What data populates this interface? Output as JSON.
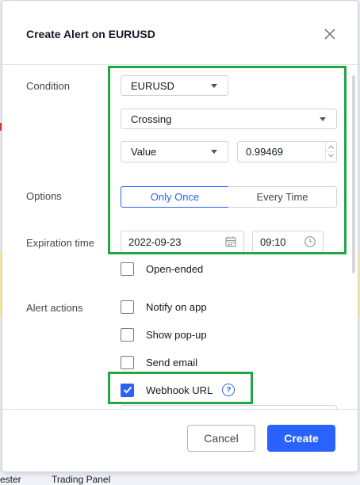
{
  "dialog": {
    "title": "Create Alert on EURUSD"
  },
  "condition": {
    "label": "Condition",
    "symbol": "EURUSD",
    "operator": "Crossing",
    "source": "Value",
    "value": "0.99469"
  },
  "options": {
    "label": "Options",
    "only_once": "Only Once",
    "every_time": "Every Time",
    "selected": "Only Once"
  },
  "expiration": {
    "label": "Expiration time",
    "date": "2022-09-23",
    "time": "09:10",
    "open_ended": "Open-ended",
    "open_ended_checked": false
  },
  "actions": {
    "label": "Alert actions",
    "items": [
      {
        "label": "Notify on app",
        "checked": false
      },
      {
        "label": "Show pop-up",
        "checked": false
      },
      {
        "label": "Send email",
        "checked": false
      },
      {
        "label": "Webhook URL",
        "checked": true
      }
    ]
  },
  "footer": {
    "cancel": "Cancel",
    "create": "Create"
  },
  "background": {
    "bottom_left": "ester",
    "bottom_mid": "Trading Panel"
  },
  "colors": {
    "accent": "#2962ff",
    "highlight": "#22a548"
  }
}
